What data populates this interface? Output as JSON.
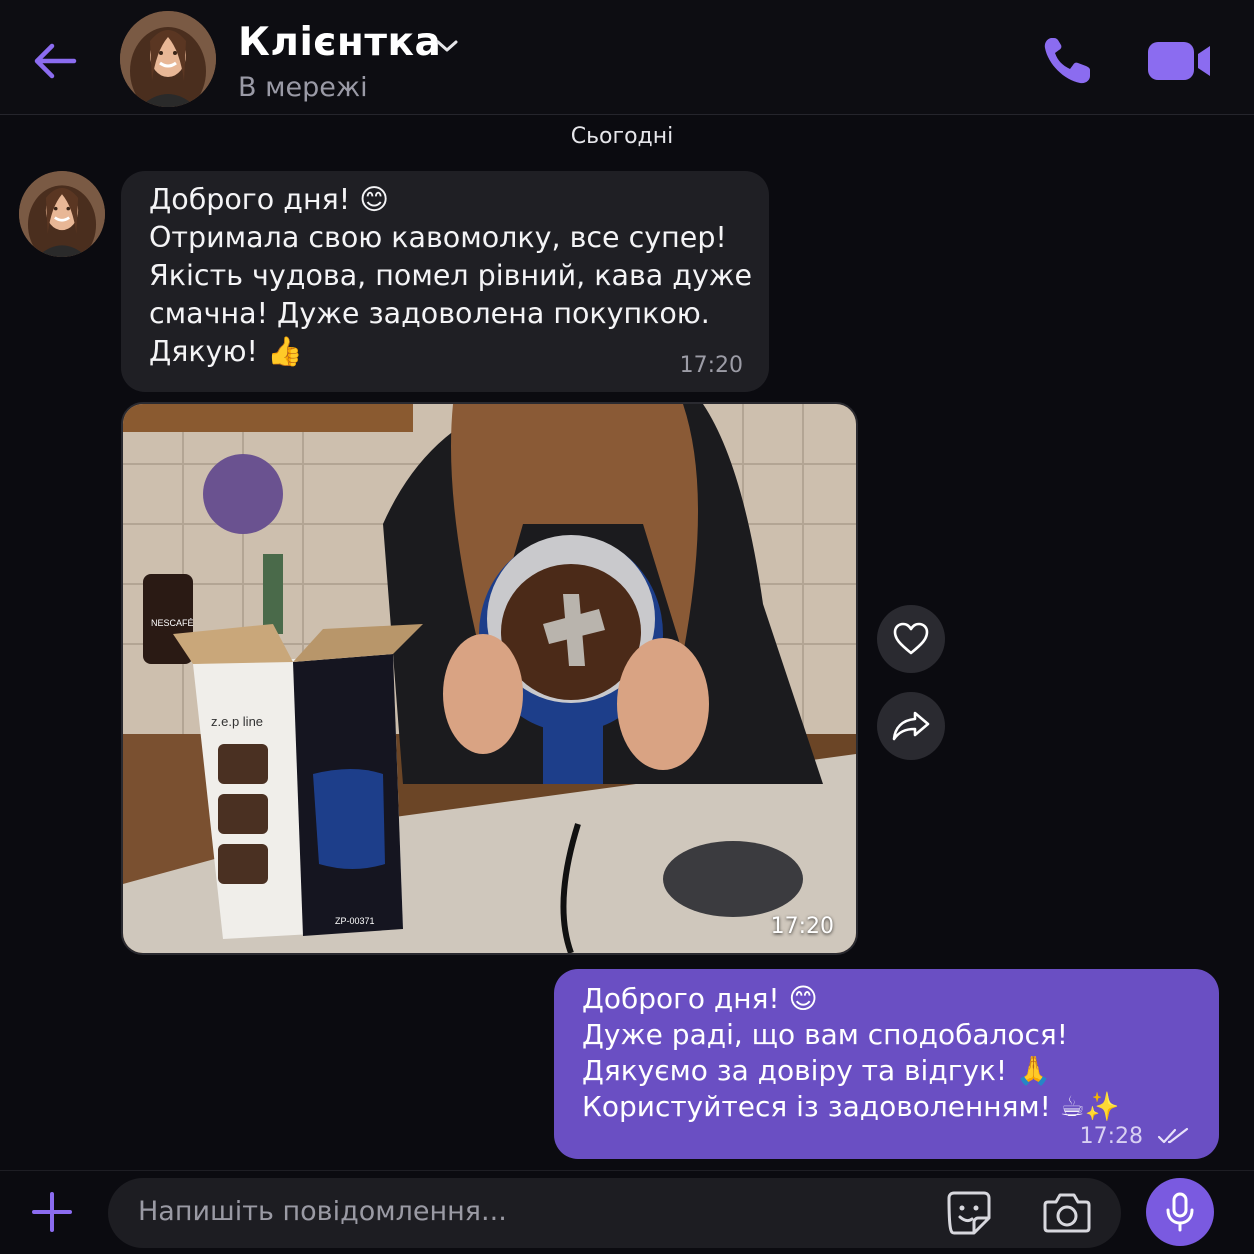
{
  "header": {
    "contact_name": "Клієнтка",
    "status": "В мережі"
  },
  "chat": {
    "date_separator": "Сьогодні",
    "incoming_message": {
      "lines": [
        "Доброго дня! 😊",
        "Отримала свою кавомолку, все супер!",
        "Якість чудова, помел рівний, кава дуже",
        "смачна! Дуже задоволена покупкою.",
        "Дякую! 👍"
      ],
      "time": "17:20"
    },
    "photo_message": {
      "time": "17:20",
      "box_brand": "z.e.p line",
      "box_model": "ZP-00371",
      "jar_label": "NESCAFÉ"
    },
    "outgoing_message": {
      "lines": [
        "Доброго дня! 😊",
        "Дуже раді, що вам сподобалося!",
        "Дякуємо за довіру та відгук! 🙏",
        "Користуйтеся із задоволенням! ☕✨"
      ],
      "time": "17:28"
    }
  },
  "composer": {
    "placeholder": "Напишіть повідомлення..."
  },
  "colors": {
    "accent": "#8b6cf0",
    "outgoing_bubble": "#6a4fc3",
    "incoming_bubble": "#1f1f24",
    "background": "#0b0b10"
  },
  "icons": {
    "back": "arrow-left-icon",
    "chevron": "chevron-down-icon",
    "call": "phone-icon",
    "video": "video-camera-icon",
    "like": "heart-icon",
    "share": "share-arrow-icon",
    "add": "plus-icon",
    "sticker": "sticker-icon",
    "camera": "camera-icon",
    "mic": "microphone-icon",
    "read": "double-check-icon"
  }
}
